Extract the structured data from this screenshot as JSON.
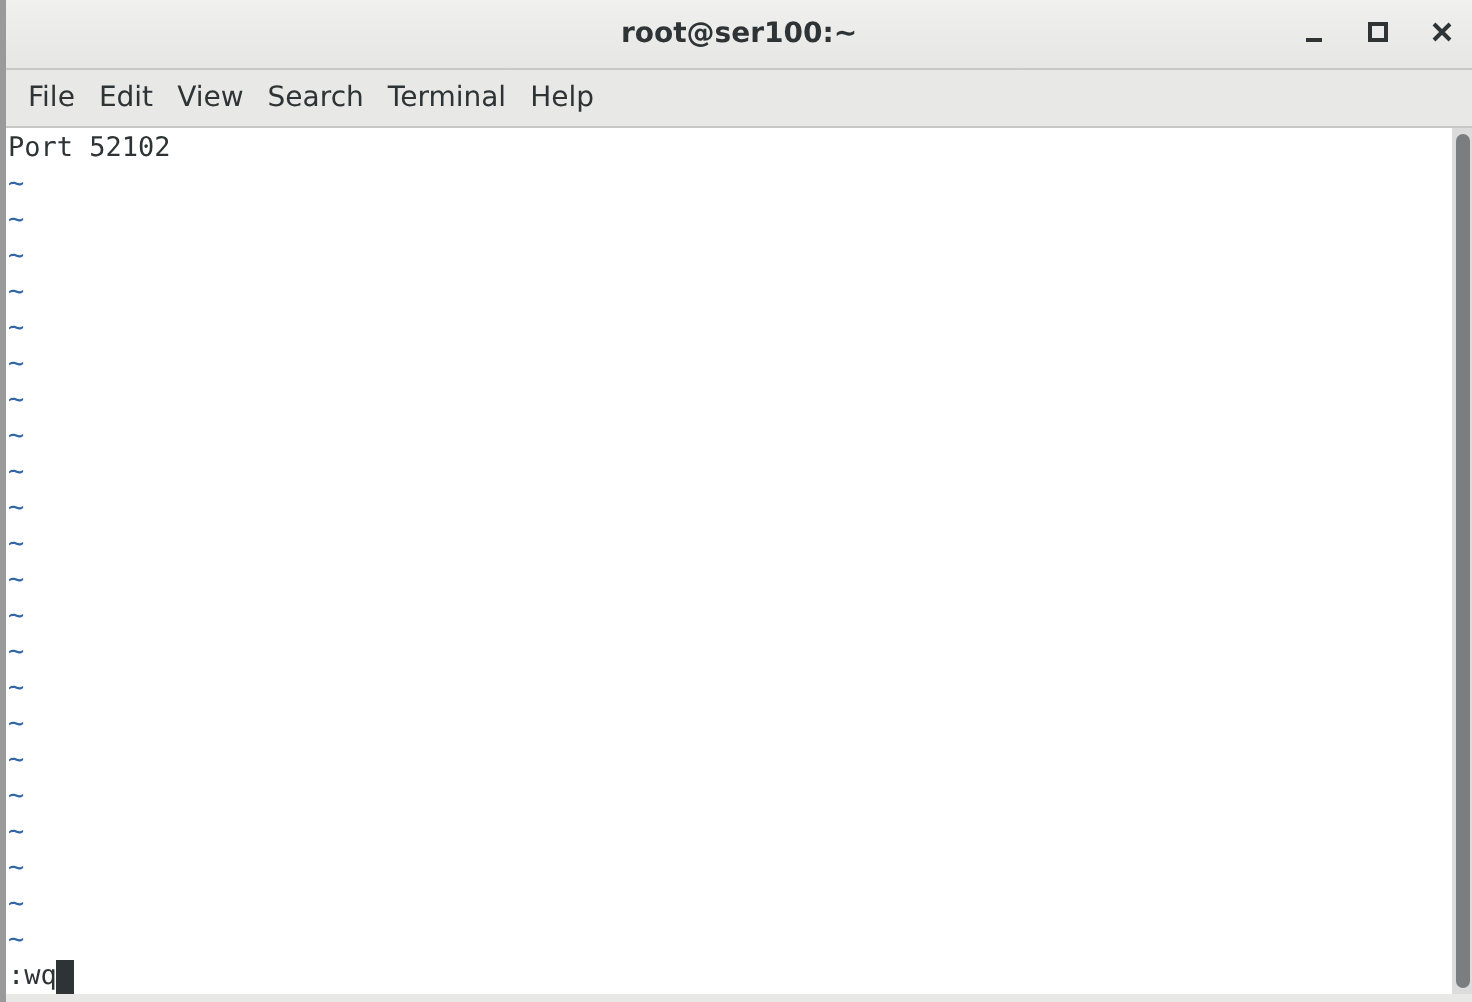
{
  "window": {
    "title": "root@ser100:~"
  },
  "menu": [
    {
      "label": "File"
    },
    {
      "label": "Edit"
    },
    {
      "label": "View"
    },
    {
      "label": "Search"
    },
    {
      "label": "Terminal"
    },
    {
      "label": "Help"
    }
  ],
  "terminal": {
    "lines": [
      {
        "kind": "text",
        "text": "Port 52102"
      },
      {
        "kind": "filler",
        "text": "~"
      },
      {
        "kind": "filler",
        "text": "~"
      },
      {
        "kind": "filler",
        "text": "~"
      },
      {
        "kind": "filler",
        "text": "~"
      },
      {
        "kind": "filler",
        "text": "~"
      },
      {
        "kind": "filler",
        "text": "~"
      },
      {
        "kind": "filler",
        "text": "~"
      },
      {
        "kind": "filler",
        "text": "~"
      },
      {
        "kind": "filler",
        "text": "~"
      },
      {
        "kind": "filler",
        "text": "~"
      },
      {
        "kind": "filler",
        "text": "~"
      },
      {
        "kind": "filler",
        "text": "~"
      },
      {
        "kind": "filler",
        "text": "~"
      },
      {
        "kind": "filler",
        "text": "~"
      },
      {
        "kind": "filler",
        "text": "~"
      },
      {
        "kind": "filler",
        "text": "~"
      },
      {
        "kind": "filler",
        "text": "~"
      },
      {
        "kind": "filler",
        "text": "~"
      },
      {
        "kind": "filler",
        "text": "~"
      },
      {
        "kind": "filler",
        "text": "~"
      },
      {
        "kind": "filler",
        "text": "~"
      },
      {
        "kind": "filler",
        "text": "~"
      }
    ],
    "command": ":wq"
  }
}
